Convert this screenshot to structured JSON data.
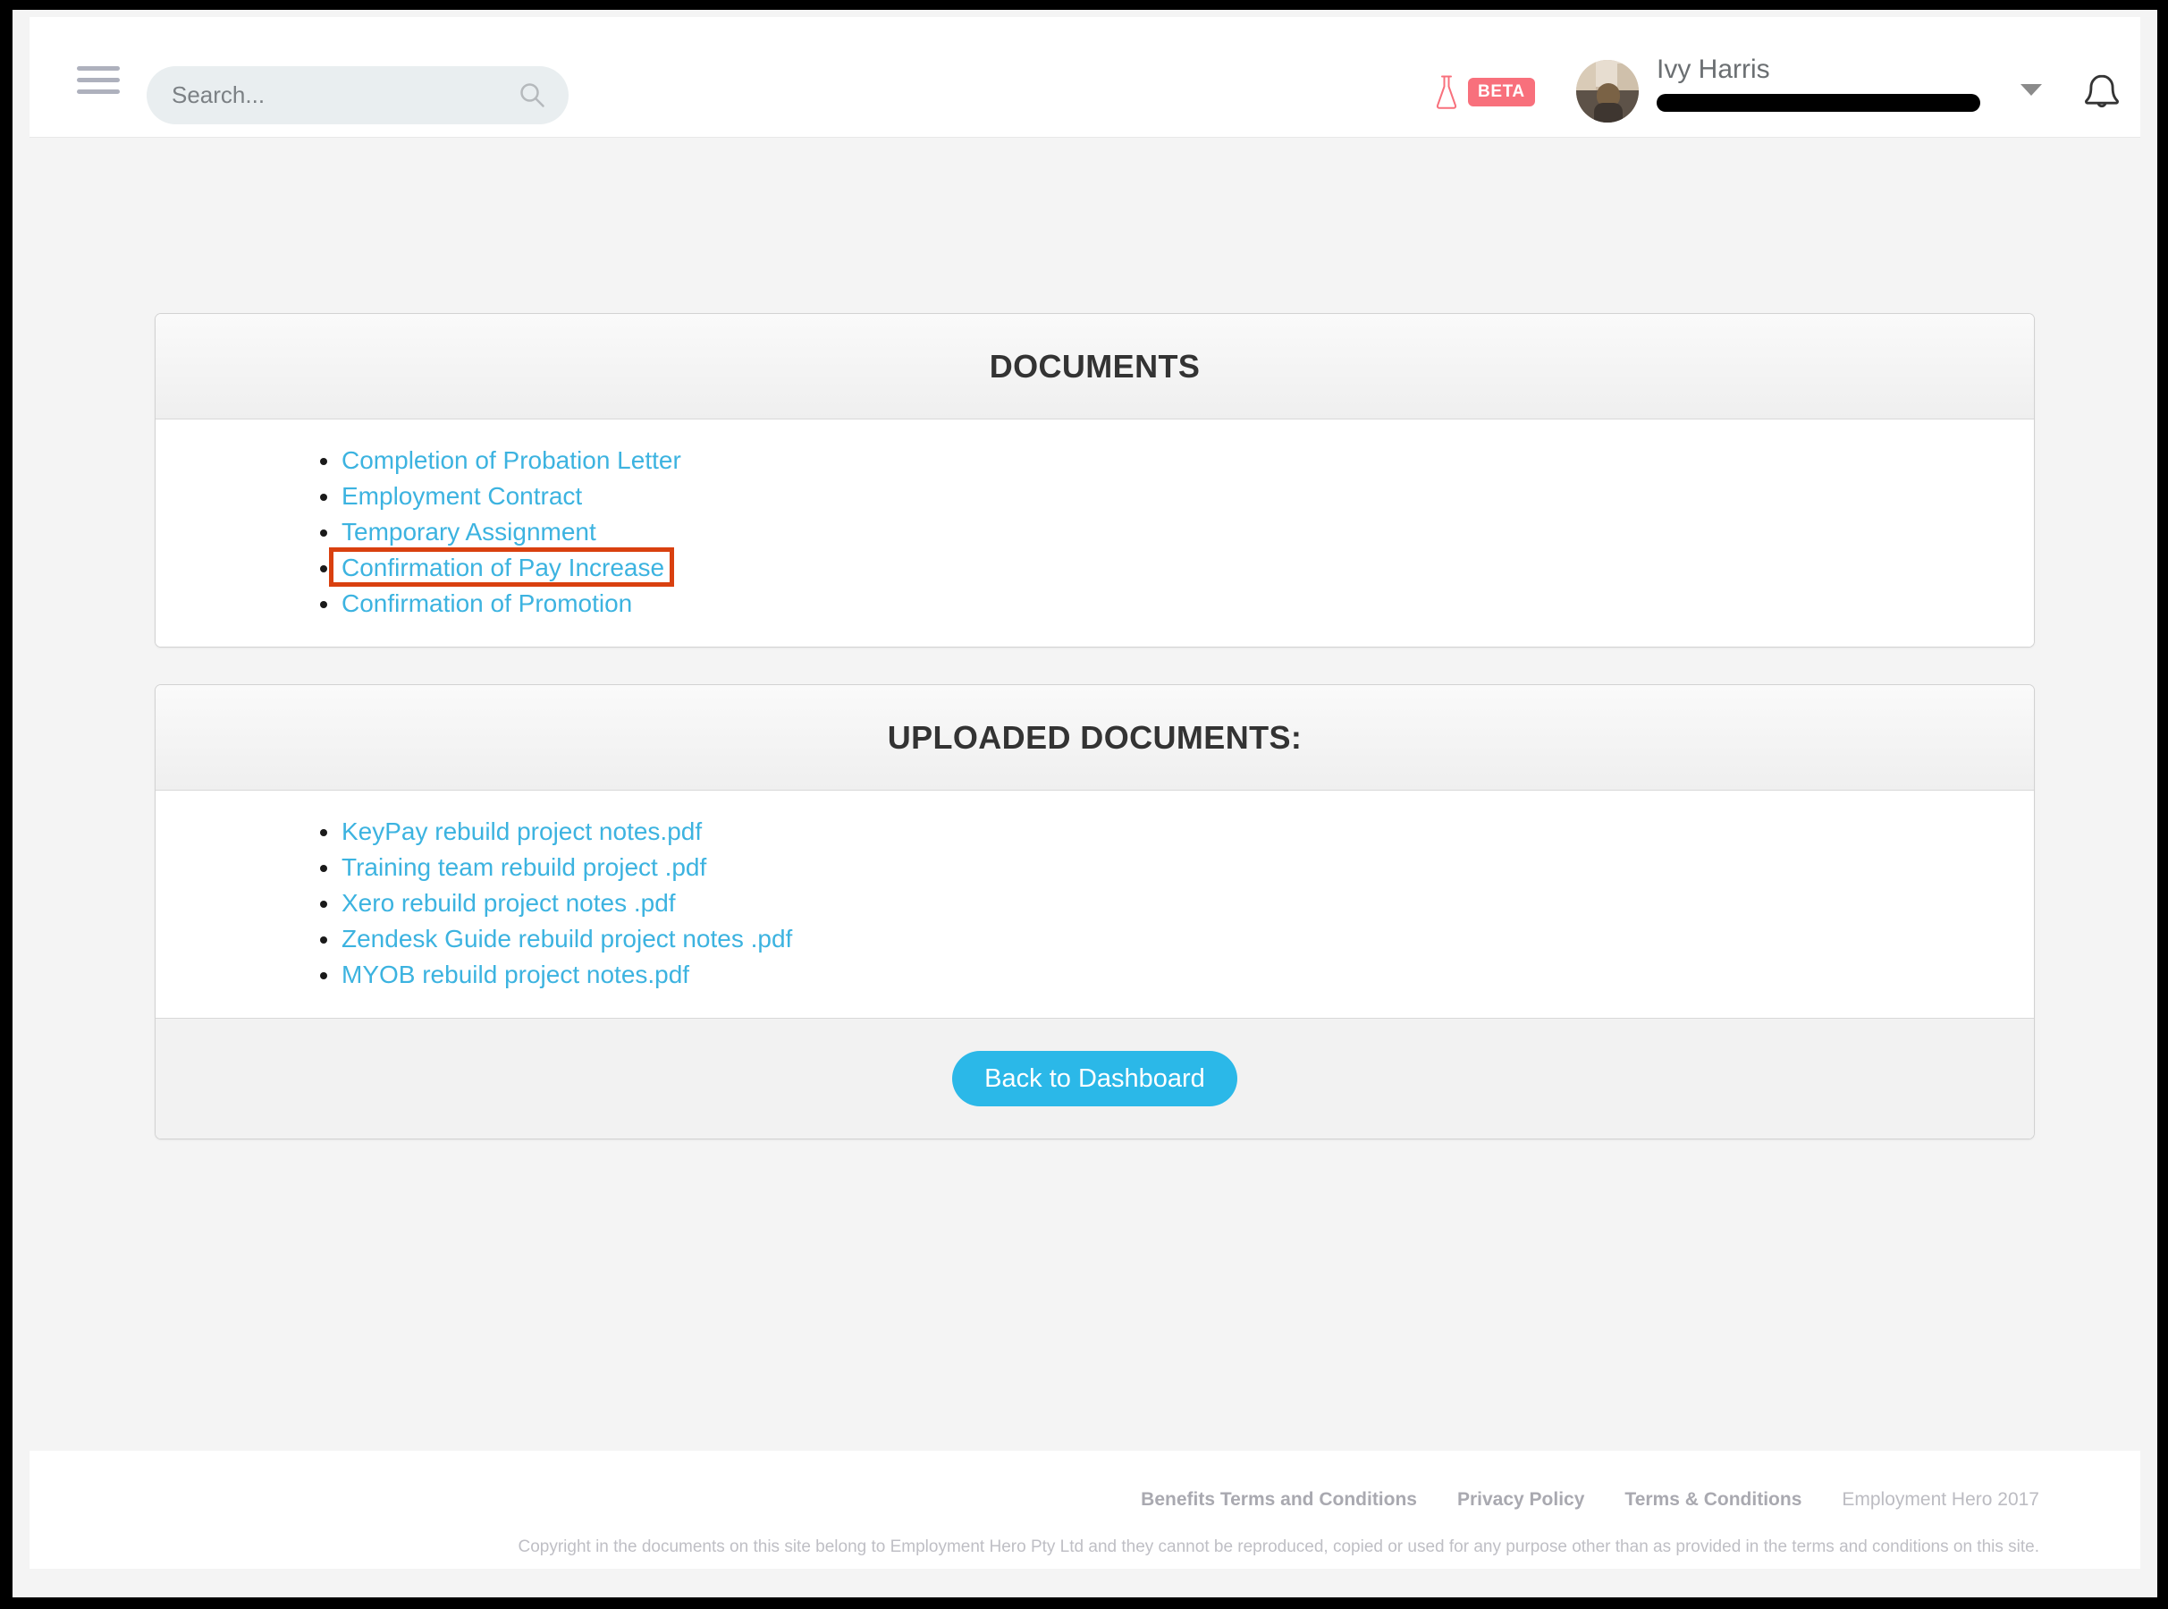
{
  "header": {
    "menu_icon": "hamburger-menu-icon",
    "search": {
      "placeholder": "Search...",
      "value": "",
      "icon": "search-icon"
    },
    "beta": {
      "icon": "flask-icon",
      "badge_label": "BETA",
      "badge_color": "#f8707c"
    },
    "user": {
      "name": "Ivy Harris",
      "email_redacted": true,
      "avatar_icon": "user-avatar-photo",
      "chevron_icon": "chevron-down-icon"
    },
    "notifications_icon": "bell-icon"
  },
  "main": {
    "documents_panel": {
      "title": "DOCUMENTS",
      "items": [
        {
          "label": "Completion of Probation Letter",
          "annotated": false
        },
        {
          "label": "Employment Contract",
          "annotated": false
        },
        {
          "label": "Temporary Assignment",
          "annotated": false
        },
        {
          "label": "Confirmation of Pay Increase",
          "annotated": true
        },
        {
          "label": "Confirmation of Promotion",
          "annotated": false
        }
      ]
    },
    "uploaded_panel": {
      "title": "UPLOADED DOCUMENTS:",
      "items": [
        {
          "label": "KeyPay rebuild project notes.pdf"
        },
        {
          "label": "Training team rebuild project .pdf"
        },
        {
          "label": "Xero rebuild project notes .pdf"
        },
        {
          "label": "Zendesk Guide rebuild project notes .pdf"
        },
        {
          "label": "MYOB rebuild project notes.pdf"
        }
      ],
      "back_button_label": "Back to Dashboard"
    }
  },
  "footer": {
    "links": [
      "Benefits Terms and Conditions",
      "Privacy Policy",
      "Terms & Conditions",
      "Employment Hero 2017"
    ],
    "copyright": "Copyright in the documents on this site belong to Employment Hero Pty Ltd and they cannot be reproduced, copied or used for any purpose other than as provided in the terms and conditions on this site."
  },
  "colors": {
    "link_blue": "#3cb3e0",
    "button_blue": "#2bb8e8",
    "annotation_red": "#d9400f",
    "beta_pink": "#f8707c"
  }
}
